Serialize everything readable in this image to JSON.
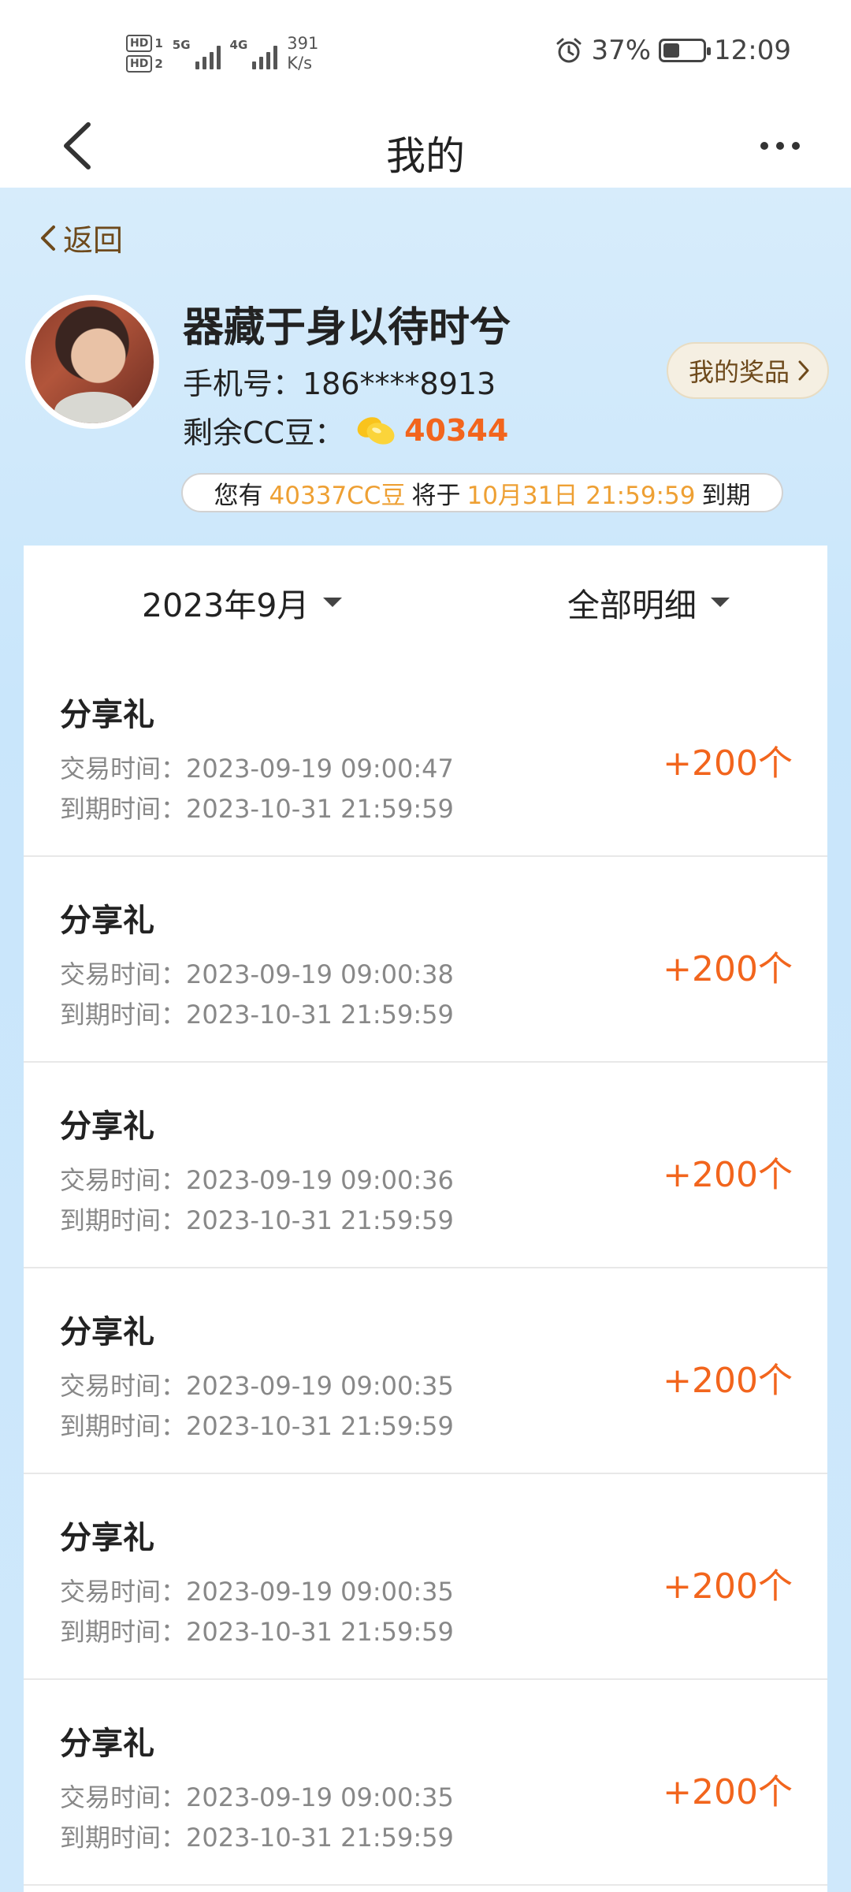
{
  "status_bar": {
    "hd1": "HD",
    "hd1_num": "1",
    "hd2": "HD",
    "hd2_num": "2",
    "sig1_label": "5G",
    "sig2_label": "4G",
    "speed_value": "391",
    "speed_unit": "K/s",
    "battery_percent": "37%",
    "battery_level": 0.37,
    "time": "12:09"
  },
  "nav": {
    "title": "我的"
  },
  "header": {
    "back_label": "返回",
    "user_name": "器藏于身以待时兮",
    "phone": "手机号：186****8913",
    "beans_label": "剩余CC豆：",
    "beans_count": "40344",
    "prizes_label": "我的奖品",
    "expire": {
      "prefix": "您有",
      "amount": "40337CC豆",
      "middle": "将于",
      "date": "10月31日 21:59:59",
      "suffix": "到期"
    }
  },
  "filters": {
    "month": "2023年9月",
    "type": "全部明细"
  },
  "records": [
    {
      "title": "分享礼",
      "trade": "交易时间：2023-09-19 09:00:47",
      "expire": "到期时间：2023-10-31 21:59:59",
      "amount": "+200个"
    },
    {
      "title": "分享礼",
      "trade": "交易时间：2023-09-19 09:00:38",
      "expire": "到期时间：2023-10-31 21:59:59",
      "amount": "+200个"
    },
    {
      "title": "分享礼",
      "trade": "交易时间：2023-09-19 09:00:36",
      "expire": "到期时间：2023-10-31 21:59:59",
      "amount": "+200个"
    },
    {
      "title": "分享礼",
      "trade": "交易时间：2023-09-19 09:00:35",
      "expire": "到期时间：2023-10-31 21:59:59",
      "amount": "+200个"
    },
    {
      "title": "分享礼",
      "trade": "交易时间：2023-09-19 09:00:35",
      "expire": "到期时间：2023-10-31 21:59:59",
      "amount": "+200个"
    },
    {
      "title": "分享礼",
      "trade": "交易时间：2023-09-19 09:00:35",
      "expire": "到期时间：2023-10-31 21:59:59",
      "amount": "+200个"
    }
  ],
  "colors": {
    "accent_orange": "#f2651d",
    "highlight_gold": "#eea034",
    "back_brown": "#6e4a1c",
    "header_blue": "#cfe8fb"
  },
  "icons": {
    "nav_back": "chevron-left-icon",
    "nav_more": "more-dots-icon",
    "alarm": "alarm-clock-icon",
    "battery": "battery-icon",
    "bean": "bean-icon"
  }
}
